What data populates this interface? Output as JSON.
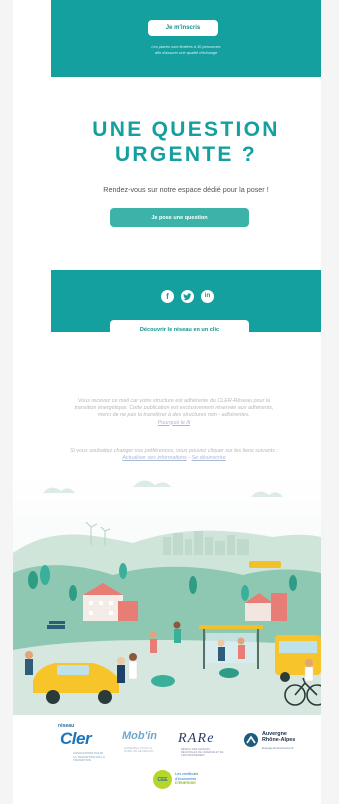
{
  "hero": {
    "register_button": "Je m'inscris",
    "limit_line_1": "Les places sont limitées à 30 personnes",
    "limit_line_2": "afin d'assurer une qualité d'échange"
  },
  "question": {
    "title_line_1": "UNE QUESTION",
    "title_line_2": "URGENTE ?",
    "subtitle": "Rendez-vous sur notre espace dédié pour la poser !",
    "ask_button": "Je pose une question"
  },
  "social": {
    "icons": [
      "facebook-icon",
      "twitter-icon",
      "linkedin-icon"
    ],
    "discover_button": "Découvrir le réseau en un clic"
  },
  "footer": {
    "line_1": "Vous recevez ce mail car votre structure est adhérente du CLER-Réseau pour la",
    "line_2": "transition énergétique. Cette publication est exclusivement réservée aux adhérents,",
    "line_3": "merci de ne pas la transférer à des structures non - adhérentes.",
    "privacy_link": "Pourquoi le lit",
    "prefs_line": "Si vous souhaitez changer vos préférences, vous pouvez cliquer sur les liens suivants :",
    "update_link": "Actualiser ses informations",
    "separator": " - ",
    "unsubscribe_link": "Se désinscrire"
  },
  "logos": {
    "cler_prefix": "réseau",
    "cler_name": "Cler",
    "cler_tagline": "ASSOCIATION POUR LA TRANSITION DE LA TRANSITION",
    "mobin_name": "Mob'in",
    "mobin_tagline": "ENSEMBLE POUR LA MOBILITÉ DE DEMAIN",
    "rare_name": "RARe",
    "rare_tagline": "RÉSEAU DES AGENCES RÉGIONALES DE L'ÉNERGIE ET DE L'ENVIRONNEMENT",
    "ara_line_1": "Auvergne",
    "ara_line_2": "Rhône-Alpes",
    "ara_tagline": "Energie Environnement",
    "cee_badge": "CEE",
    "cee_line_1": "Les certificats",
    "cee_line_2": "d'économies",
    "cee_line_3": "D'ÉNERGIE"
  },
  "colors": {
    "teal": "#15a0a0",
    "button_teal": "#3bb3a9",
    "footer_grey": "#b8b8b8",
    "link_blue": "#a9b8d8"
  }
}
